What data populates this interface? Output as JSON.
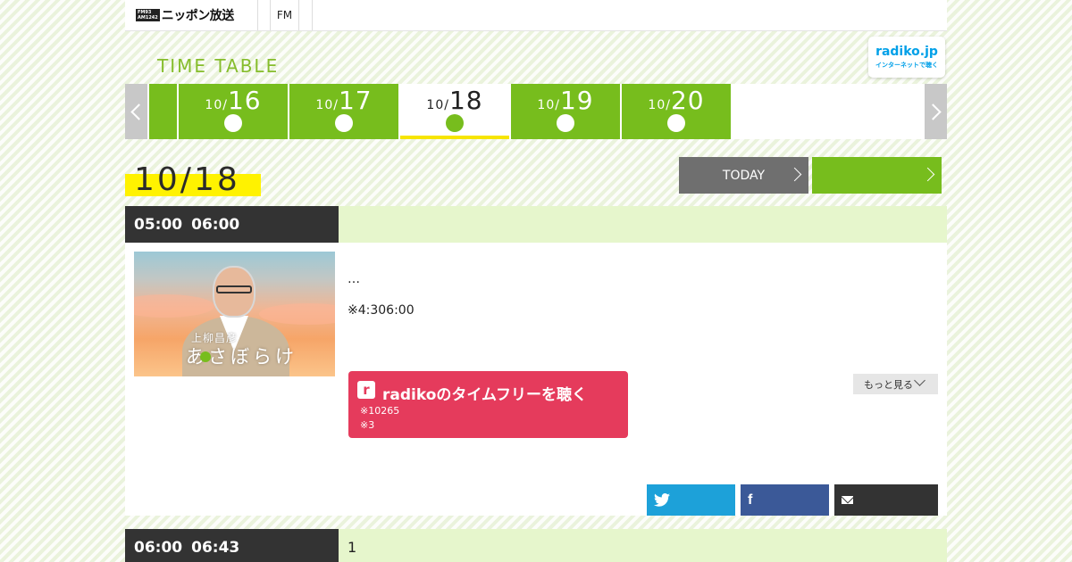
{
  "header": {
    "logo_mark_top": "FM93",
    "logo_mark_bottom": "AM1242",
    "logo_text": "ニッポン放送",
    "nav_fm": "FM"
  },
  "timetable": {
    "title": "TIME TABLE"
  },
  "radiko_logo": {
    "name": "radiko.jp",
    "sub": "インターネットで聴く"
  },
  "date_tabs": [
    {
      "month": "10/",
      "day": "16",
      "active": false
    },
    {
      "month": "10/",
      "day": "17",
      "active": false
    },
    {
      "month": "10/",
      "day": "18",
      "active": true
    },
    {
      "month": "10/",
      "day": "19",
      "active": false
    },
    {
      "month": "10/",
      "day": "20",
      "active": false
    }
  ],
  "current_date": "10/18",
  "buttons": {
    "today": "TODAY"
  },
  "slots": [
    {
      "start": "05:00",
      "end": "06:00",
      "title": ""
    },
    {
      "start": "06:00",
      "end": "06:43",
      "title": "1"
    }
  ],
  "program": {
    "image_name": "上柳昌彦",
    "image_title": "あさぼらけ",
    "description": "…",
    "note": "※4:306:00",
    "radiko_button": {
      "icon": "r",
      "label": "radikoのタイムフリーを聴く",
      "note1": "※10265",
      "note2": "※3"
    },
    "more": "もっと見る"
  },
  "colors": {
    "brand_green": "#77bd1d",
    "title_green": "#86bd2c",
    "highlight_yellow": "#fff200",
    "radiko_pink": "#e53b5c",
    "twitter_blue": "#1da1d9",
    "facebook_blue": "#3b5998",
    "time_bar_dark": "#333333"
  },
  "icons": {
    "prev": "chevron-left-icon",
    "next": "chevron-right-icon",
    "twitter": "twitter-icon",
    "facebook": "facebook-icon",
    "mail": "mail-icon"
  }
}
